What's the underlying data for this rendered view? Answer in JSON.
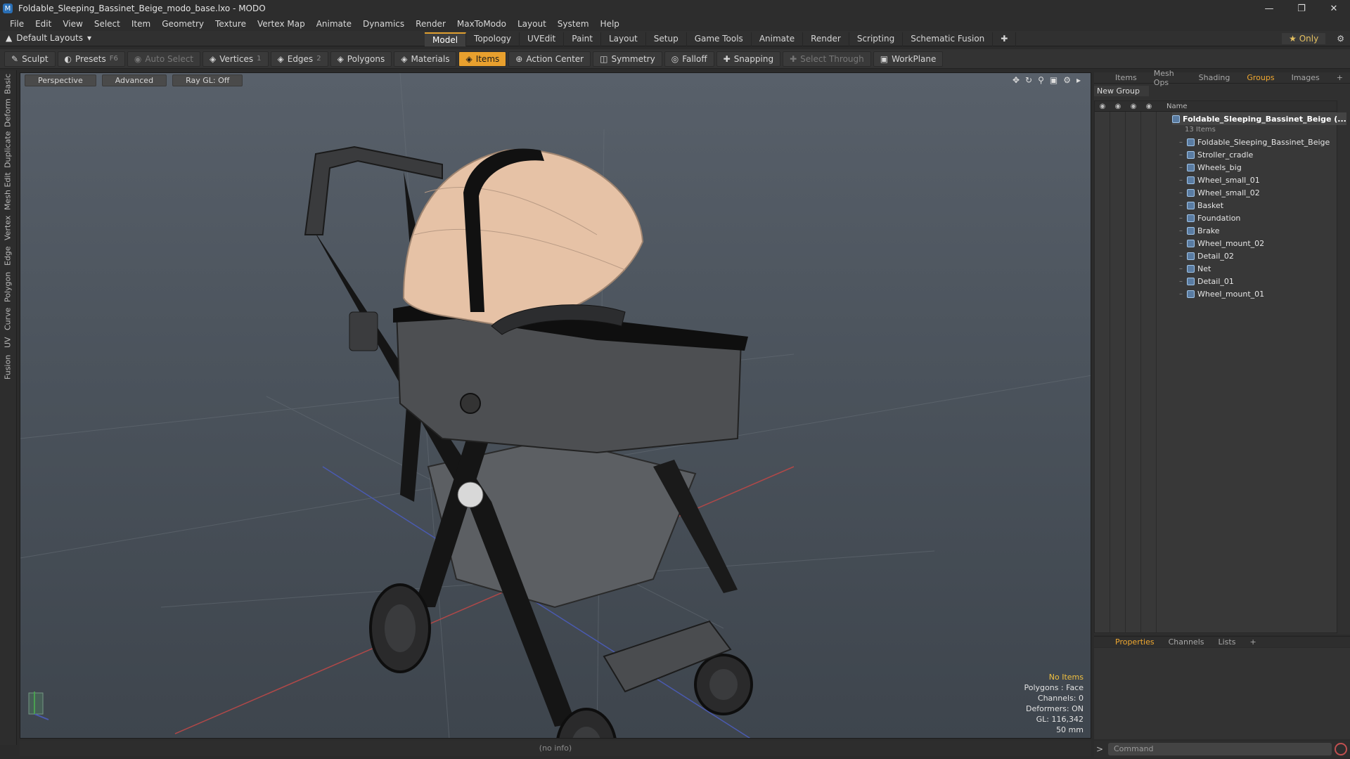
{
  "window": {
    "title": "Foldable_Sleeping_Bassinet_Beige_modo_base.lxo - MODO"
  },
  "menu": [
    "File",
    "Edit",
    "View",
    "Select",
    "Item",
    "Geometry",
    "Texture",
    "Vertex Map",
    "Animate",
    "Dynamics",
    "Render",
    "MaxToModo",
    "Layout",
    "System",
    "Help"
  ],
  "layout_selector": "Default Layouts",
  "tabs": [
    "Model",
    "Topology",
    "UVEdit",
    "Paint",
    "Layout",
    "Setup",
    "Game Tools",
    "Animate",
    "Render",
    "Scripting",
    "Schematic Fusion"
  ],
  "active_tab": "Model",
  "only_label": "Only",
  "toolbar": {
    "sculpt": "Sculpt",
    "presets": "Presets",
    "presets_key": "F6",
    "auto_select": "Auto Select",
    "vertices": "Vertices",
    "vertices_count": "1",
    "edges": "Edges",
    "edges_count": "2",
    "polygons": "Polygons",
    "materials": "Materials",
    "items": "Items",
    "action_center": "Action Center",
    "symmetry": "Symmetry",
    "falloff": "Falloff",
    "snapping": "Snapping",
    "select_through": "Select Through",
    "workplane": "WorkPlane"
  },
  "left_tabs": [
    "Basic",
    "Deform",
    "Duplicate",
    "Mesh Edit",
    "Vertex",
    "Edge",
    "Polygon",
    "Curve",
    "UV",
    "Fusion"
  ],
  "viewport": {
    "view": "Perspective",
    "shading": "Advanced",
    "raygl": "Ray GL: Off",
    "info": {
      "items": "No Items",
      "polygons": "Polygons : Face",
      "channels": "Channels: 0",
      "deformers": "Deformers: ON",
      "gl": "GL: 116,342",
      "distance": "50 mm"
    }
  },
  "status_text": "(no info)",
  "right_panel": {
    "tabs": [
      "Items",
      "Mesh Ops",
      "Shading",
      "Groups",
      "Images"
    ],
    "active_tab": "Groups",
    "new_group": "New Group",
    "column_name": "Name",
    "root": "Foldable_Sleeping_Bassinet_Beige",
    "root_suffix": "(...",
    "root_count": "13 Items",
    "items": [
      "Foldable_Sleeping_Bassinet_Beige",
      "Stroller_cradle",
      "Wheels_big",
      "Wheel_small_01",
      "Wheel_small_02",
      "Basket",
      "Foundation",
      "Brake",
      "Wheel_mount_02",
      "Detail_02",
      "Net",
      "Detail_01",
      "Wheel_mount_01"
    ]
  },
  "bottom_panel": {
    "tabs": [
      "Properties",
      "Channels",
      "Lists"
    ],
    "active_tab": "Properties"
  },
  "command_placeholder": "Command",
  "colors": {
    "accent": "#e8a02e",
    "viewport_top": "#58606a",
    "viewport_bottom": "#3e454d",
    "canopy": "#e6c2a6",
    "frame": "#141414"
  }
}
